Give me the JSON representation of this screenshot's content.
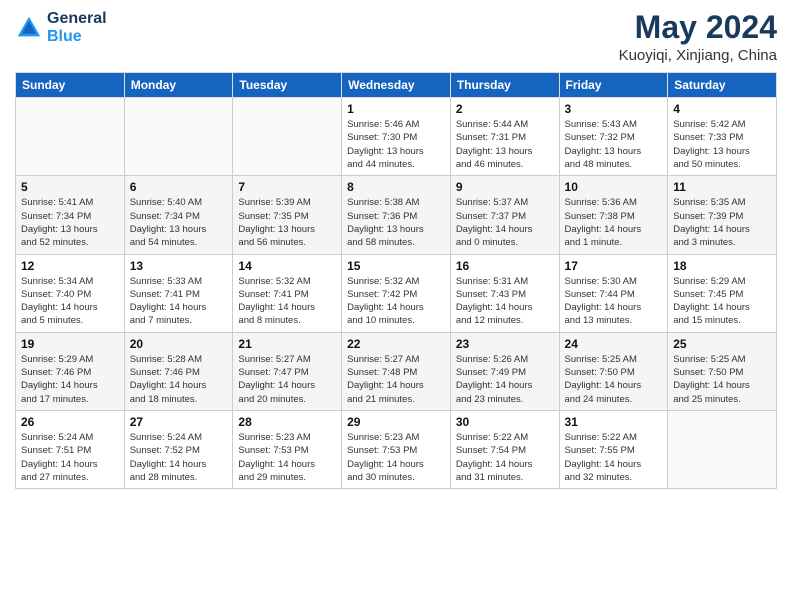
{
  "header": {
    "logo_line1": "General",
    "logo_line2": "Blue",
    "title": "May 2024",
    "subtitle": "Kuoyiqi, Xinjiang, China"
  },
  "days_of_week": [
    "Sunday",
    "Monday",
    "Tuesday",
    "Wednesday",
    "Thursday",
    "Friday",
    "Saturday"
  ],
  "weeks": [
    [
      {
        "day": "",
        "info": ""
      },
      {
        "day": "",
        "info": ""
      },
      {
        "day": "",
        "info": ""
      },
      {
        "day": "1",
        "info": "Sunrise: 5:46 AM\nSunset: 7:30 PM\nDaylight: 13 hours\nand 44 minutes."
      },
      {
        "day": "2",
        "info": "Sunrise: 5:44 AM\nSunset: 7:31 PM\nDaylight: 13 hours\nand 46 minutes."
      },
      {
        "day": "3",
        "info": "Sunrise: 5:43 AM\nSunset: 7:32 PM\nDaylight: 13 hours\nand 48 minutes."
      },
      {
        "day": "4",
        "info": "Sunrise: 5:42 AM\nSunset: 7:33 PM\nDaylight: 13 hours\nand 50 minutes."
      }
    ],
    [
      {
        "day": "5",
        "info": "Sunrise: 5:41 AM\nSunset: 7:34 PM\nDaylight: 13 hours\nand 52 minutes."
      },
      {
        "day": "6",
        "info": "Sunrise: 5:40 AM\nSunset: 7:34 PM\nDaylight: 13 hours\nand 54 minutes."
      },
      {
        "day": "7",
        "info": "Sunrise: 5:39 AM\nSunset: 7:35 PM\nDaylight: 13 hours\nand 56 minutes."
      },
      {
        "day": "8",
        "info": "Sunrise: 5:38 AM\nSunset: 7:36 PM\nDaylight: 13 hours\nand 58 minutes."
      },
      {
        "day": "9",
        "info": "Sunrise: 5:37 AM\nSunset: 7:37 PM\nDaylight: 14 hours\nand 0 minutes."
      },
      {
        "day": "10",
        "info": "Sunrise: 5:36 AM\nSunset: 7:38 PM\nDaylight: 14 hours\nand 1 minute."
      },
      {
        "day": "11",
        "info": "Sunrise: 5:35 AM\nSunset: 7:39 PM\nDaylight: 14 hours\nand 3 minutes."
      }
    ],
    [
      {
        "day": "12",
        "info": "Sunrise: 5:34 AM\nSunset: 7:40 PM\nDaylight: 14 hours\nand 5 minutes."
      },
      {
        "day": "13",
        "info": "Sunrise: 5:33 AM\nSunset: 7:41 PM\nDaylight: 14 hours\nand 7 minutes."
      },
      {
        "day": "14",
        "info": "Sunrise: 5:32 AM\nSunset: 7:41 PM\nDaylight: 14 hours\nand 8 minutes."
      },
      {
        "day": "15",
        "info": "Sunrise: 5:32 AM\nSunset: 7:42 PM\nDaylight: 14 hours\nand 10 minutes."
      },
      {
        "day": "16",
        "info": "Sunrise: 5:31 AM\nSunset: 7:43 PM\nDaylight: 14 hours\nand 12 minutes."
      },
      {
        "day": "17",
        "info": "Sunrise: 5:30 AM\nSunset: 7:44 PM\nDaylight: 14 hours\nand 13 minutes."
      },
      {
        "day": "18",
        "info": "Sunrise: 5:29 AM\nSunset: 7:45 PM\nDaylight: 14 hours\nand 15 minutes."
      }
    ],
    [
      {
        "day": "19",
        "info": "Sunrise: 5:29 AM\nSunset: 7:46 PM\nDaylight: 14 hours\nand 17 minutes."
      },
      {
        "day": "20",
        "info": "Sunrise: 5:28 AM\nSunset: 7:46 PM\nDaylight: 14 hours\nand 18 minutes."
      },
      {
        "day": "21",
        "info": "Sunrise: 5:27 AM\nSunset: 7:47 PM\nDaylight: 14 hours\nand 20 minutes."
      },
      {
        "day": "22",
        "info": "Sunrise: 5:27 AM\nSunset: 7:48 PM\nDaylight: 14 hours\nand 21 minutes."
      },
      {
        "day": "23",
        "info": "Sunrise: 5:26 AM\nSunset: 7:49 PM\nDaylight: 14 hours\nand 23 minutes."
      },
      {
        "day": "24",
        "info": "Sunrise: 5:25 AM\nSunset: 7:50 PM\nDaylight: 14 hours\nand 24 minutes."
      },
      {
        "day": "25",
        "info": "Sunrise: 5:25 AM\nSunset: 7:50 PM\nDaylight: 14 hours\nand 25 minutes."
      }
    ],
    [
      {
        "day": "26",
        "info": "Sunrise: 5:24 AM\nSunset: 7:51 PM\nDaylight: 14 hours\nand 27 minutes."
      },
      {
        "day": "27",
        "info": "Sunrise: 5:24 AM\nSunset: 7:52 PM\nDaylight: 14 hours\nand 28 minutes."
      },
      {
        "day": "28",
        "info": "Sunrise: 5:23 AM\nSunset: 7:53 PM\nDaylight: 14 hours\nand 29 minutes."
      },
      {
        "day": "29",
        "info": "Sunrise: 5:23 AM\nSunset: 7:53 PM\nDaylight: 14 hours\nand 30 minutes."
      },
      {
        "day": "30",
        "info": "Sunrise: 5:22 AM\nSunset: 7:54 PM\nDaylight: 14 hours\nand 31 minutes."
      },
      {
        "day": "31",
        "info": "Sunrise: 5:22 AM\nSunset: 7:55 PM\nDaylight: 14 hours\nand 32 minutes."
      },
      {
        "day": "",
        "info": ""
      }
    ]
  ]
}
